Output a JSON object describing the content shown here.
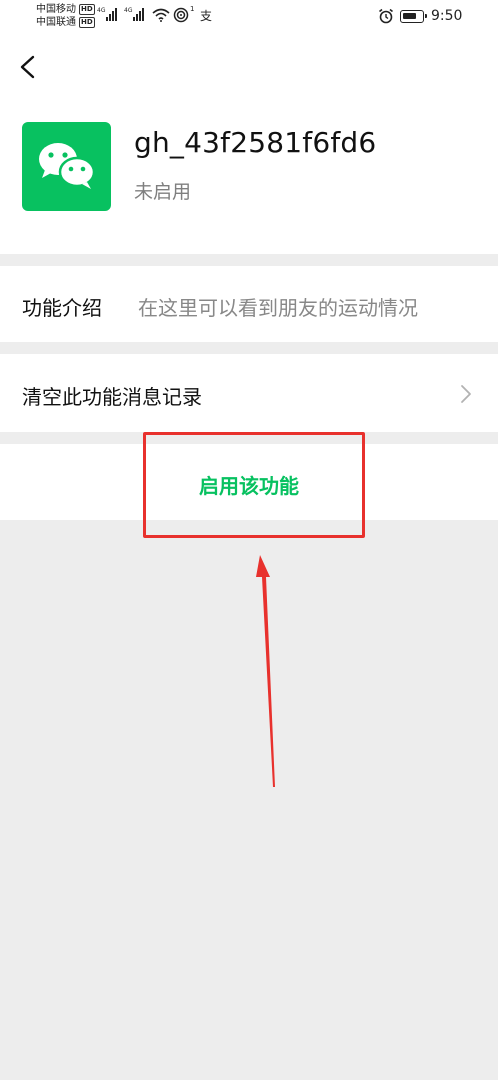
{
  "status_bar": {
    "carrier1": "中国移动",
    "carrier2": "中国联通",
    "hd_badge": "HD",
    "net1": "4G",
    "net2": "4G",
    "hotspot_count": "1",
    "pay_glyph": "支",
    "time": "9:50"
  },
  "header": {
    "back_icon": "chevron-left-icon",
    "account_name": "gh_43f2581f6fd6",
    "account_status": "未启用",
    "logo_color": "#08c160"
  },
  "rows": {
    "intro_label": "功能介绍",
    "intro_value": "在这里可以看到朋友的运动情况",
    "clear_label": "清空此功能消息记录",
    "enable_label": "启用该功能"
  },
  "colors": {
    "accent": "#07c160",
    "annotation": "#e8312d",
    "background": "#ededed"
  }
}
